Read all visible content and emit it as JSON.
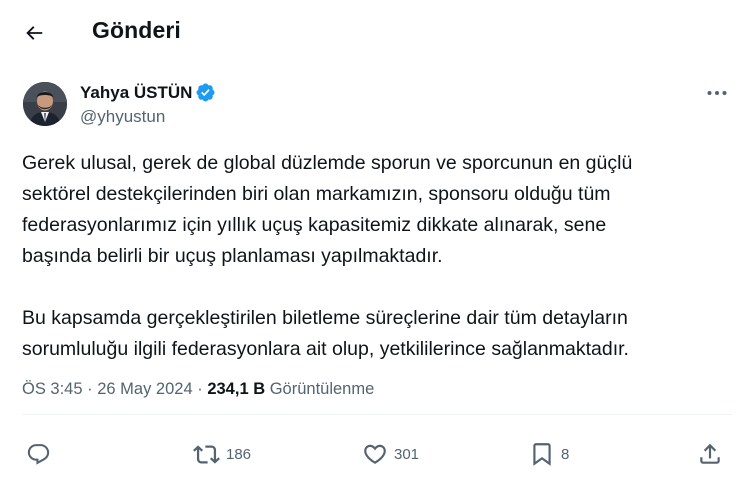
{
  "header": {
    "title": "Gönderi",
    "back_icon": "arrow-left-icon"
  },
  "author": {
    "name": "Yahya ÜSTÜN",
    "handle": "@yhyustun",
    "verified": true,
    "verified_color": "#1d9bf0"
  },
  "tweet": {
    "paragraph1": [
      "Gerek ulusal, gerek de global düzlemde sporun ve sporcunun en güçlü",
      "sektörel destekçilerinden biri olan markamızın,  sponsoru olduğu tüm",
      "federasyonlarımız için yıllık uçuş kapasitemiz dikkate alınarak, sene",
      "başında belirli bir uçuş planlaması yapılmaktadır."
    ],
    "paragraph2": [
      "Bu kapsamda gerçekleştirilen biletleme süreçlerine dair tüm detayların",
      "sorumluluğu ilgili federasyonlara ait olup, yetkililerince sağlanmaktadır."
    ]
  },
  "meta": {
    "time": "ÖS 3:45",
    "separator": "·",
    "date": "26 May 2024",
    "views_count": "234,1 B",
    "views_label": "Görüntülenme"
  },
  "actions": {
    "reply": {
      "icon": "reply-icon",
      "count": ""
    },
    "retweet": {
      "icon": "retweet-icon",
      "count": "186"
    },
    "like": {
      "icon": "heart-icon",
      "count": "301"
    },
    "bookmark": {
      "icon": "bookmark-icon",
      "count": "8"
    },
    "share": {
      "icon": "share-icon",
      "count": ""
    }
  },
  "colors": {
    "text": "#0f1419",
    "secondary": "#536471",
    "accent": "#1d9bf0",
    "divider": "#eff3f4"
  }
}
